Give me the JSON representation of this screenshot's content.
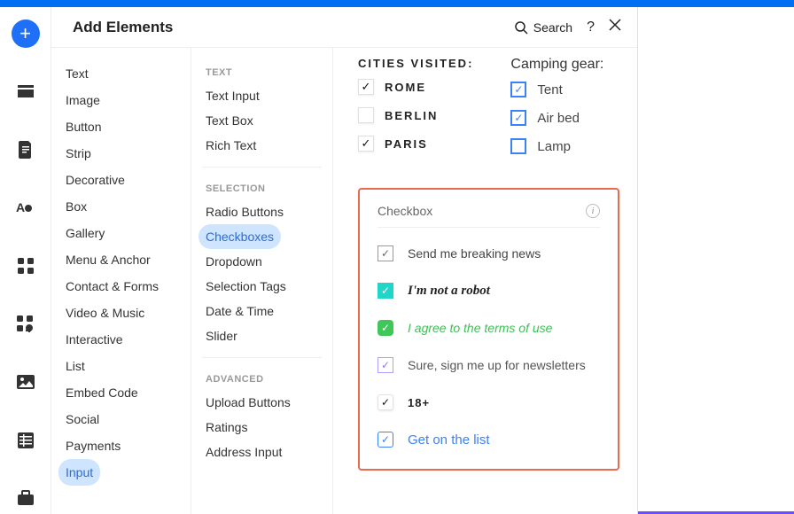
{
  "header": {
    "title": "Add Elements",
    "search_label": "Search"
  },
  "col1": [
    {
      "label": "Text",
      "active": false
    },
    {
      "label": "Image",
      "active": false
    },
    {
      "label": "Button",
      "active": false
    },
    {
      "label": "Strip",
      "active": false
    },
    {
      "label": "Decorative",
      "active": false
    },
    {
      "label": "Box",
      "active": false
    },
    {
      "label": "Gallery",
      "active": false
    },
    {
      "label": "Menu & Anchor",
      "active": false
    },
    {
      "label": "Contact & Forms",
      "active": false
    },
    {
      "label": "Video & Music",
      "active": false
    },
    {
      "label": "Interactive",
      "active": false
    },
    {
      "label": "List",
      "active": false
    },
    {
      "label": "Embed Code",
      "active": false
    },
    {
      "label": "Social",
      "active": false
    },
    {
      "label": "Payments",
      "active": false
    },
    {
      "label": "Input",
      "active": true
    }
  ],
  "col2": {
    "sections": [
      {
        "title": "TEXT",
        "items": [
          {
            "label": "Text Input",
            "active": false
          },
          {
            "label": "Text Box",
            "active": false
          },
          {
            "label": "Rich Text",
            "active": false
          }
        ]
      },
      {
        "title": "SELECTION",
        "items": [
          {
            "label": "Radio Buttons",
            "active": false
          },
          {
            "label": "Checkboxes",
            "active": true
          },
          {
            "label": "Dropdown",
            "active": false
          },
          {
            "label": "Selection Tags",
            "active": false
          },
          {
            "label": "Date & Time",
            "active": false
          },
          {
            "label": "Slider",
            "active": false
          }
        ]
      },
      {
        "title": "ADVANCED",
        "items": [
          {
            "label": "Upload Buttons",
            "active": false
          },
          {
            "label": "Ratings",
            "active": false
          },
          {
            "label": "Address Input",
            "active": false
          }
        ]
      }
    ]
  },
  "preview": {
    "cities_heading": "CITIES VISITED:",
    "cities": [
      {
        "label": "ROME",
        "checked": true
      },
      {
        "label": "BERLIN",
        "checked": false
      },
      {
        "label": "PARIS",
        "checked": true
      }
    ],
    "camping_heading": "Camping gear:",
    "gear": [
      {
        "label": "Tent",
        "checked": true
      },
      {
        "label": "Air bed",
        "checked": true
      },
      {
        "label": "Lamp",
        "checked": false
      }
    ],
    "highlight_title": "Checkbox",
    "samples": [
      {
        "text": "Send me breaking news"
      },
      {
        "text": "I'm not a robot"
      },
      {
        "text": "I agree to the terms of use"
      },
      {
        "text": "Sure, sign me up for newsletters"
      },
      {
        "text": "18+"
      },
      {
        "text": "Get on the list"
      }
    ]
  }
}
